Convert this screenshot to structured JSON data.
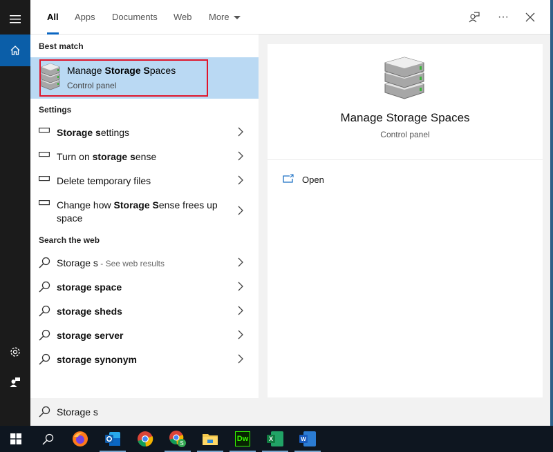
{
  "rail": {
    "menu_icon": "hamburger-icon",
    "home_icon": "home-icon",
    "settings_icon": "gear-icon",
    "feedback_icon": "feedback-hub-icon"
  },
  "tabs": [
    {
      "label": "All",
      "active": true
    },
    {
      "label": "Apps",
      "active": false
    },
    {
      "label": "Documents",
      "active": false
    },
    {
      "label": "Web",
      "active": false
    },
    {
      "label": "More",
      "active": false
    }
  ],
  "top_actions": {
    "feedback_icon": "feedback-icon",
    "more_icon": "ellipsis-icon",
    "more_text": "···",
    "close_icon": "close-icon"
  },
  "sections": {
    "best_match": "Best match",
    "settings": "Settings",
    "web": "Search the web"
  },
  "best_match": {
    "title_prefix": "Manage ",
    "title_bold": "Storage S",
    "title_suffix": "paces",
    "subtitle": "Control panel",
    "icon": "storage-spaces-icon",
    "highlight_color": "#bad9f3",
    "box_color": "#e0142a"
  },
  "settings_items": [
    {
      "pre": "",
      "bold": "Storage s",
      "post": "ettings",
      "icon": "settings-panel-icon"
    },
    {
      "pre": "Turn on ",
      "bold": "storage s",
      "post": "ense",
      "icon": "settings-panel-icon"
    },
    {
      "pre": "Delete temporary files",
      "bold": "",
      "post": "",
      "icon": "settings-panel-icon"
    },
    {
      "pre": "Change how ",
      "bold": "Storage S",
      "post": "ense frees up space",
      "icon": "settings-panel-icon"
    }
  ],
  "web_items": [
    {
      "pre": "Storage s",
      "bold": "",
      "post": "",
      "hint": " - See web results",
      "icon": "search-icon"
    },
    {
      "pre": "",
      "bold": "storage space",
      "post": "",
      "hint": "",
      "icon": "search-icon"
    },
    {
      "pre": "",
      "bold": "storage sheds",
      "post": "",
      "hint": "",
      "icon": "search-icon"
    },
    {
      "pre": "",
      "bold": "storage server",
      "post": "",
      "hint": "",
      "icon": "search-icon"
    },
    {
      "pre": "",
      "bold": "storage synonym",
      "post": "",
      "hint": "",
      "icon": "search-icon"
    }
  ],
  "preview": {
    "title": "Manage Storage Spaces",
    "subtitle": "Control panel",
    "actions": [
      {
        "label": "Open",
        "icon": "open-window-icon"
      }
    ]
  },
  "search": {
    "value": "Storage s",
    "icon": "search-icon"
  },
  "taskbar": {
    "items": [
      {
        "name": "start",
        "icon": "windows-start-icon"
      },
      {
        "name": "search",
        "icon": "search-icon"
      },
      {
        "name": "firefox",
        "icon": "firefox-icon"
      },
      {
        "name": "outlook",
        "icon": "outlook-icon"
      },
      {
        "name": "chrome",
        "icon": "chrome-icon"
      },
      {
        "name": "chrome-profile",
        "icon": "chrome-profile-icon"
      },
      {
        "name": "file-explorer",
        "icon": "folder-icon"
      },
      {
        "name": "dreamweaver",
        "icon": "dreamweaver-icon",
        "text": "Dw"
      },
      {
        "name": "excel",
        "icon": "excel-icon",
        "text": "X"
      },
      {
        "name": "word",
        "icon": "word-icon",
        "text": "W"
      }
    ]
  },
  "colors": {
    "accent": "#0a66c2",
    "rail_active": "#0b5ea8",
    "taskbar": "#0e1620"
  }
}
